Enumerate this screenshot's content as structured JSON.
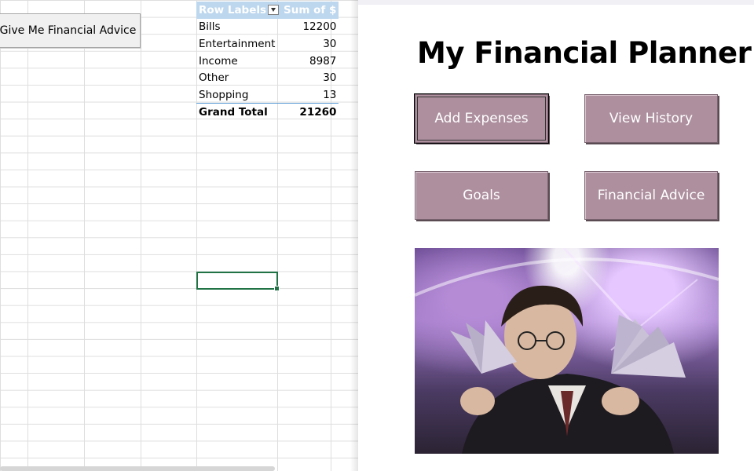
{
  "sheet": {
    "macro_button_label": "Give Me Financial Advice",
    "pivot": {
      "headers": [
        "Row Labels",
        "Sum of $"
      ],
      "rows": [
        {
          "label": "Bills",
          "value": "12200"
        },
        {
          "label": "Entertainment",
          "value": "30"
        },
        {
          "label": "Income",
          "value": "8987"
        },
        {
          "label": "Other",
          "value": "30"
        },
        {
          "label": "Shopping",
          "value": "13"
        }
      ],
      "total": {
        "label": "Grand Total",
        "value": "21260"
      }
    }
  },
  "form": {
    "title": "My Financial Planner!",
    "buttons": {
      "add_expenses": "Add Expenses",
      "view_history": "View History",
      "goals": "Goals",
      "financial_advice": "Financial Advice"
    },
    "picture_subject": "wizard-holding-cash-fans-photo"
  },
  "colors": {
    "button_fill": "#ad8f9e",
    "pivot_header": "#bdd7ee",
    "selection": "#217346"
  }
}
